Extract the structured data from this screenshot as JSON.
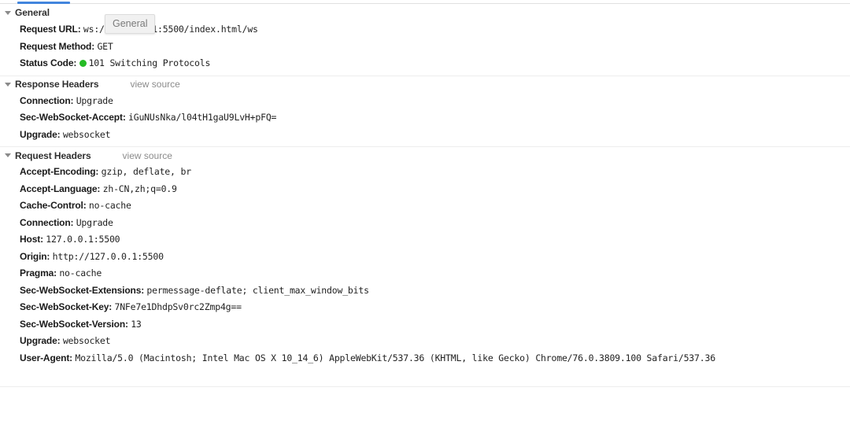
{
  "tabstrip": {
    "active_tab_indicator": "headers-tab-indicator"
  },
  "tooltip": {
    "text": "General"
  },
  "sections": [
    {
      "title": "General",
      "view_source_label": "",
      "has_view_source": false,
      "rows": [
        {
          "name": "Request URL:",
          "value": "ws://127.0.0.1:5500/index.html/ws",
          "status_dot": false
        },
        {
          "name": "Request Method:",
          "value": "GET",
          "status_dot": false
        },
        {
          "name": "Status Code:",
          "value": "101 Switching Protocols",
          "status_dot": true,
          "status_color": "#25bb25"
        }
      ]
    },
    {
      "title": "Response Headers",
      "view_source_label": "view source",
      "has_view_source": true,
      "rows": [
        {
          "name": "Connection:",
          "value": "Upgrade",
          "status_dot": false
        },
        {
          "name": "Sec-WebSocket-Accept:",
          "value": "iGuNUsNka/l04tH1gaU9LvH+pFQ=",
          "status_dot": false
        },
        {
          "name": "Upgrade:",
          "value": "websocket",
          "status_dot": false
        }
      ]
    },
    {
      "title": "Request Headers",
      "view_source_label": "view source",
      "has_view_source": true,
      "rows": [
        {
          "name": "Accept-Encoding:",
          "value": "gzip, deflate, br",
          "status_dot": false
        },
        {
          "name": "Accept-Language:",
          "value": "zh-CN,zh;q=0.9",
          "status_dot": false
        },
        {
          "name": "Cache-Control:",
          "value": "no-cache",
          "status_dot": false
        },
        {
          "name": "Connection:",
          "value": "Upgrade",
          "status_dot": false
        },
        {
          "name": "Host:",
          "value": "127.0.0.1:5500",
          "status_dot": false
        },
        {
          "name": "Origin:",
          "value": "http://127.0.0.1:5500",
          "status_dot": false
        },
        {
          "name": "Pragma:",
          "value": "no-cache",
          "status_dot": false
        },
        {
          "name": "Sec-WebSocket-Extensions:",
          "value": "permessage-deflate; client_max_window_bits",
          "status_dot": false
        },
        {
          "name": "Sec-WebSocket-Key:",
          "value": "7NFe7e1DhdpSv0rc2Zmp4g==",
          "status_dot": false
        },
        {
          "name": "Sec-WebSocket-Version:",
          "value": "13",
          "status_dot": false
        },
        {
          "name": "Upgrade:",
          "value": "websocket",
          "status_dot": false
        },
        {
          "name": "User-Agent:",
          "value": "Mozilla/5.0 (Macintosh; Intel Mac OS X 10_14_6) AppleWebKit/537.36 (KHTML, like Gecko) Chrome/76.0.3809.100 Safari/537.36",
          "status_dot": false
        }
      ]
    }
  ]
}
